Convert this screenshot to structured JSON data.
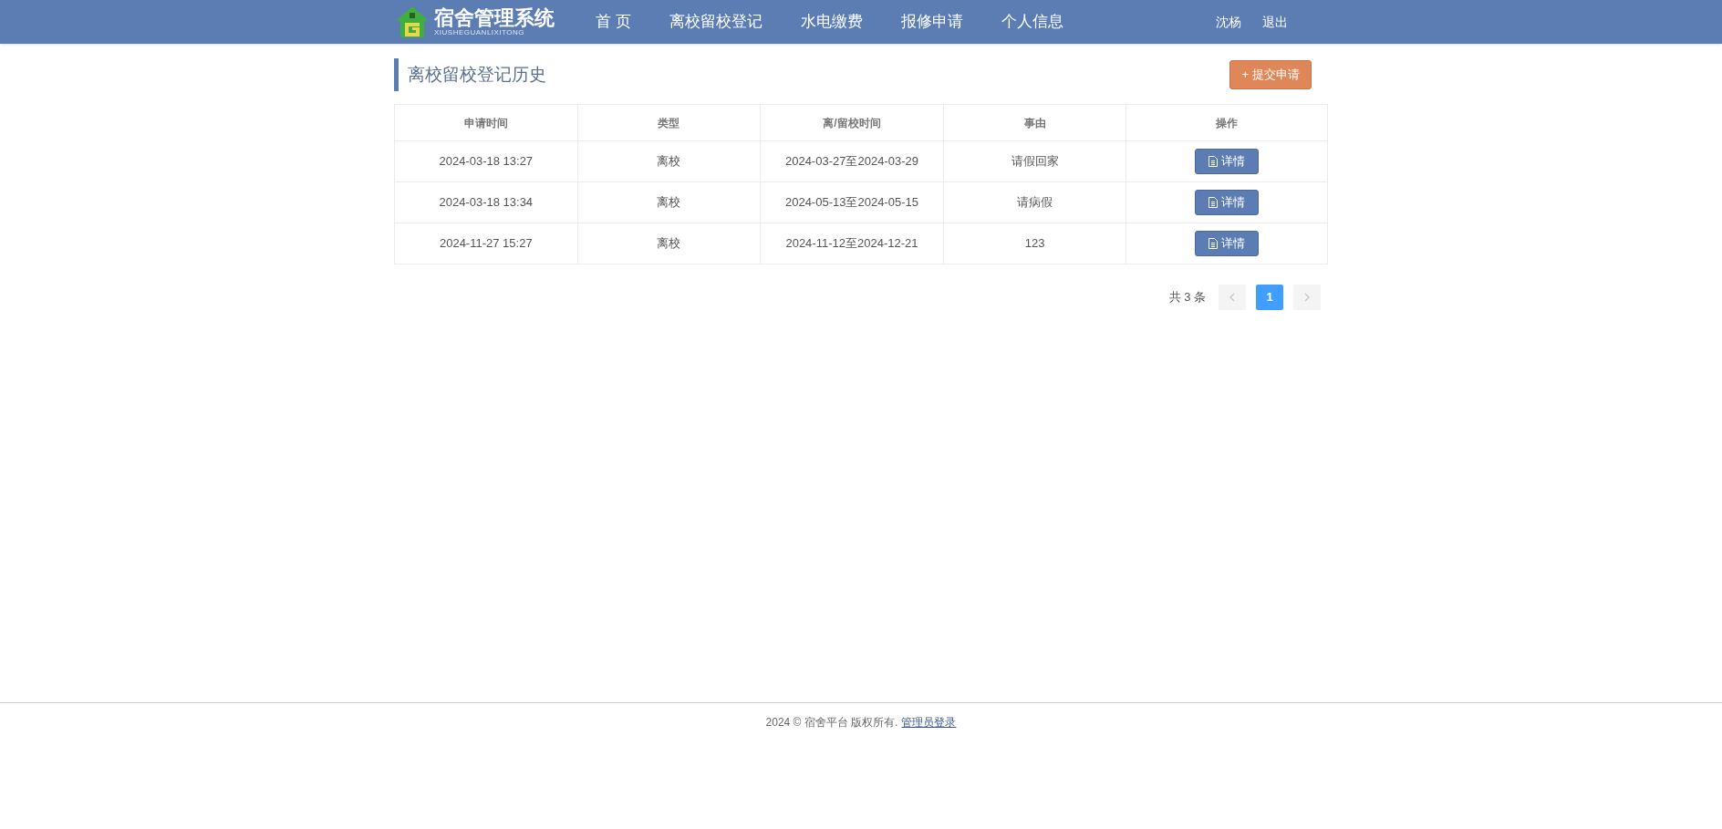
{
  "header": {
    "logo": {
      "title": "宿舍管理系统",
      "subtitle": "XIUSHEGUANLIXITONG"
    },
    "nav": [
      {
        "label": "首 页",
        "selected": false
      },
      {
        "label": "离校留校登记",
        "selected": false
      },
      {
        "label": "水电缴费",
        "selected": false
      },
      {
        "label": "报修申请",
        "selected": false
      },
      {
        "label": "个人信息",
        "selected": false
      }
    ],
    "user": "沈杨",
    "logout": "退出"
  },
  "page": {
    "title": "离校留校登记历史",
    "submit_button": {
      "icon": "+",
      "label": "提交申请"
    }
  },
  "table": {
    "columns": [
      "申请时间",
      "类型",
      "离/留校时间",
      "事由",
      "操作"
    ],
    "rows": [
      {
        "time": "2024-03-18 13:27",
        "type": "离校",
        "period": "2024-03-27至2024-03-29",
        "reason": "请假回家",
        "action": "详情"
      },
      {
        "time": "2024-03-18 13:34",
        "type": "离校",
        "period": "2024-05-13至2024-05-15",
        "reason": "请病假",
        "action": "详情"
      },
      {
        "time": "2024-11-27 15:27",
        "type": "离校",
        "period": "2024-11-12至2024-12-21",
        "reason": "123",
        "action": "详情"
      }
    ]
  },
  "pagination": {
    "total": "共 3 条",
    "prev": {
      "disabled": true
    },
    "pages": [
      {
        "label": "1",
        "selected": true
      }
    ],
    "next": {
      "disabled": true
    }
  },
  "footer": {
    "text": "2024 © 宿舍平台 版权所有.",
    "link": "管理员登录"
  }
}
